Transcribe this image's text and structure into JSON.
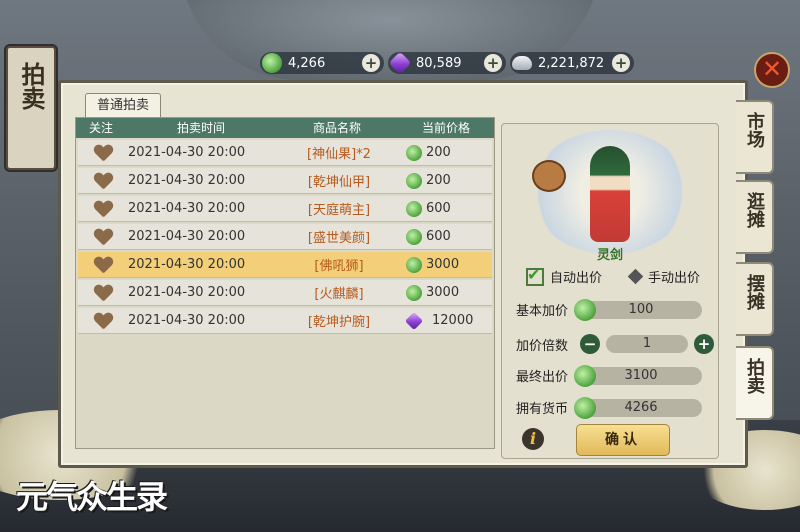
{
  "currencies": [
    {
      "icon": "jade-coin-icon",
      "value": "4,266"
    },
    {
      "icon": "purple-gem-icon",
      "value": "80,589"
    },
    {
      "icon": "silver-ingot-icon",
      "value": "2,221,872"
    }
  ],
  "banner": {
    "title": "拍卖"
  },
  "tab": {
    "label": "普通拍卖"
  },
  "table": {
    "headers": [
      "关注",
      "拍卖时间",
      "商品名称",
      "当前价格"
    ],
    "rows": [
      {
        "time": "2021-04-30 20:00",
        "name": "[神仙果]*2",
        "price": "200",
        "currency": "jade"
      },
      {
        "time": "2021-04-30 20:00",
        "name": "[乾坤仙甲]",
        "price": "200",
        "currency": "jade"
      },
      {
        "time": "2021-04-30 20:00",
        "name": "[天庭萌主]",
        "price": "600",
        "currency": "jade"
      },
      {
        "time": "2021-04-30 20:00",
        "name": "[盛世美颜]",
        "price": "600",
        "currency": "jade"
      },
      {
        "time": "2021-04-30 20:00",
        "name": "[佛吼狮]",
        "price": "3000",
        "currency": "jade",
        "selected": true
      },
      {
        "time": "2021-04-30 20:00",
        "name": "[火麒麟]",
        "price": "3000",
        "currency": "jade"
      },
      {
        "time": "2021-04-30 20:00",
        "name": "[乾坤护腕]",
        "price": "12000",
        "currency": "gem"
      }
    ]
  },
  "detail": {
    "hero_name": "灵剑",
    "auto_bid": "自动出价",
    "manual_bid": "手动出价",
    "base_increment_label": "基本加价",
    "base_increment": "100",
    "multiplier_label": "加价倍数",
    "multiplier": "1",
    "final_bid_label": "最终出价",
    "final_bid": "3100",
    "owned_label": "拥有货币",
    "owned": "4266",
    "confirm": "确认"
  },
  "side_tabs": [
    "市场",
    "逛摊",
    "摆摊",
    "拍卖"
  ],
  "logo": "元气众生录",
  "colors": {
    "header_green": "#4d7866",
    "selected_row": "#f2cf78",
    "item_name": "#b85a1e"
  }
}
